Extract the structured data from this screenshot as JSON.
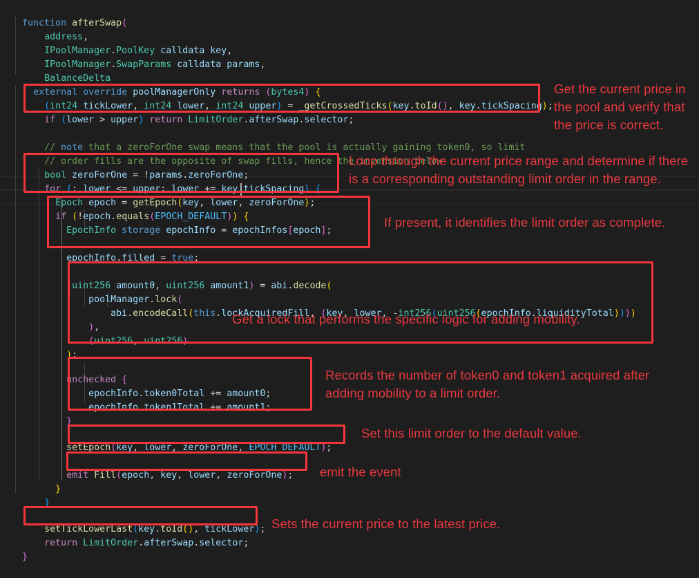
{
  "editor": {
    "background": "#1e1e1e",
    "foreground": "#d4d4d4",
    "annotation_color": "#e8393f",
    "box_color": "#f4363c",
    "language": "solidity"
  },
  "code": {
    "l01": "function afterSwap(",
    "l02": "    address,",
    "l03": "    IPoolManager.PoolKey calldata key,",
    "l04": "    IPoolManager.SwapParams calldata params,",
    "l05": "    BalanceDelta",
    "l06": ") external override poolManagerOnly returns (bytes4) {",
    "l07": "    (int24 tickLower, int24 lower, int24 upper) = _getCrossedTicks(key.toId(), key.tickSpacing);",
    "l08": "    if (lower > upper) return LimitOrder.afterSwap.selector;",
    "l09": "",
    "l10": "    // note that a zeroForOne swap means that the pool is actually gaining token0, so limit",
    "l11": "    // order fills are the opposite of swap fills, hence the inversion below",
    "l12": "    bool zeroForOne = !params.zeroForOne;",
    "l13": "    for (; lower <= upper; lower += key.tickSpacing) {",
    "l14": "        Epoch epoch = getEpoch(key, lower, zeroForOne);",
    "l15": "        if (!epoch.equals(EPOCH_DEFAULT)) {",
    "l16": "            EpochInfo storage epochInfo = epochInfos[epoch];",
    "l17": "",
    "l18": "            epochInfo.filled = true;",
    "l19": "",
    "l20": "            (uint256 amount0, uint256 amount1) = abi.decode(",
    "l21": "                poolManager.lock(",
    "l22": "                    abi.encodeCall(this.lockAcquiredFill, (key, lower, -int256(uint256(epochInfo.liquidityTotal))))",
    "l23": "                ),",
    "l24": "                (uint256, uint256)",
    "l25": "            );",
    "l26": "",
    "l27": "            unchecked {",
    "l28": "                epochInfo.token0Total += amount0;",
    "l29": "                epochInfo.token1Total += amount1;",
    "l30": "            }",
    "l31": "",
    "l32": "            setEpoch(key, lower, zeroForOne, EPOCH_DEFAULT);",
    "l33": "",
    "l34": "            emit Fill(epoch, key, lower, zeroForOne);",
    "l35": "        }",
    "l36": "    }",
    "l37": "",
    "l38": "    setTickLowerLast(key.toId(), tickLower);",
    "l39": "    return LimitOrder.afterSwap.selector;",
    "l40": "}"
  },
  "annotations": [
    {
      "id": "get-current-price",
      "text": "Get the current price in the pool and verify that the price is correct.",
      "target": "_getCrossedTicks / lower > upper guard"
    },
    {
      "id": "loop-price-range",
      "text": "Loop through the current price range and determine if there is a corresponding outstanding limit order in the range.",
      "target": "for loop over ticks / getEpoch"
    },
    {
      "id": "identifies-limit-order",
      "text": "If present, it identifies the limit order as complete.",
      "target": "epochInfo.filled = true"
    },
    {
      "id": "get-lock",
      "text": "Get a lock that performs the specific logic for adding mobility.",
      "target": "poolManager.lock / abi.decode"
    },
    {
      "id": "records-tokens",
      "text": "Records the number of token0 and token1 acquired after adding mobility to a limit order.",
      "target": "unchecked token totals"
    },
    {
      "id": "set-default-epoch",
      "text": "Set this limit order to the default value.",
      "target": "setEpoch(... EPOCH_DEFAULT)"
    },
    {
      "id": "emit-event",
      "text": "emit the event",
      "target": "emit Fill(...)"
    },
    {
      "id": "set-latest-price",
      "text": "Sets the current price to the latest price.",
      "target": "setTickLowerLast(...)"
    }
  ]
}
